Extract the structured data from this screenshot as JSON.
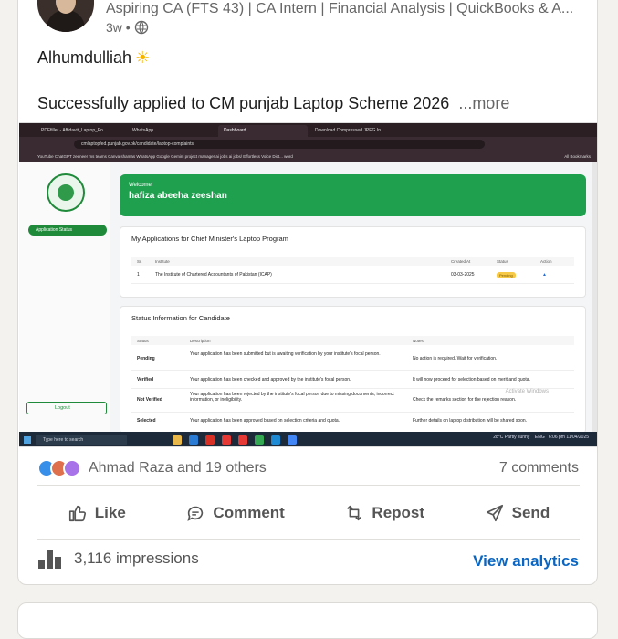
{
  "author": {
    "headline": "Aspiring CA (FTS 43) | CA Intern | Financial Analysis | QuickBooks & A...",
    "time": "3w •"
  },
  "post": {
    "line1": "Alhumdulliah",
    "line1_emoji": "☀",
    "line2": "Successfully applied to CM punjab Laptop Scheme 2026",
    "more": "...more"
  },
  "screenshot": {
    "tabs": [
      "PDFfiller - Affidavit_Laptop_Fo",
      "WhatsApp",
      "Dashboard",
      "Download Compressed JPEG In"
    ],
    "url": "cmlaptopfed.punjab.gov.pk/candidate/laptop-complaints",
    "bookmarks": "YouTube   ChatGPT   zeeneer   ms teams   Canva   shamas   WhatsApp   Google Gemini   project manager   ai jobs   ai jobs/   Effortless Voice Dict...   word",
    "all_bookmarks": "All Bookmarks",
    "welcome_label": "Welcome!",
    "welcome_name": "hafiza abeeha zeeshan",
    "app_status": "Application Status",
    "logout": "Logout",
    "applications_title": "My Applications for Chief Minister's Laptop Program",
    "app_headers": [
      "Sr.",
      "Institute",
      "Created At",
      "Status",
      "Action"
    ],
    "app_row": {
      "sr": "1",
      "institute": "The Institute of Chartered Accountants of Pakistan (ICAP)",
      "created": "03-03-2025",
      "status": "Pending"
    },
    "status_info_title": "Status Information for Candidate",
    "status_headers": [
      "Status",
      "Description",
      "Notes"
    ],
    "status_rows": [
      {
        "status": "Pending",
        "desc": "Your application has been submitted but is awaiting verification by your institute's focal person.",
        "notes": "No action is required. Wait for verification."
      },
      {
        "status": "Verified",
        "desc": "Your application has been checked and approved by the institute's focal person.",
        "notes": "It will now proceed for selection based on merit and quota."
      },
      {
        "status": "Not Verified",
        "desc": "Your application has been rejected by the institute's focal person due to missing documents, incorrect information, or ineligibility.",
        "notes": "Check the remarks section for the rejection reason."
      },
      {
        "status": "Selected",
        "desc": "Your application has been approved based on selection criteria and quota.",
        "notes": "Further details on laptop distribution will be shared soon."
      }
    ],
    "activate": "Activate Windows",
    "taskbar_search": "Type here to search",
    "weather": "28°C  Partly sunny",
    "lang": "ENG",
    "clock": "6:06 pm 11/04/2025"
  },
  "social": {
    "reactions_text": "Ahmad Raza and 19 others",
    "comments": "7 comments",
    "like": "Like",
    "comment": "Comment",
    "repost": "Repost",
    "send": "Send",
    "impressions": "3,116 impressions",
    "view_analytics": "View analytics"
  },
  "colors": {
    "accent": "#0a66c2",
    "green": "#1fa04f",
    "like_blue": "#378fe9",
    "love_red": "#df704d",
    "support_purple": "#a872e8"
  }
}
